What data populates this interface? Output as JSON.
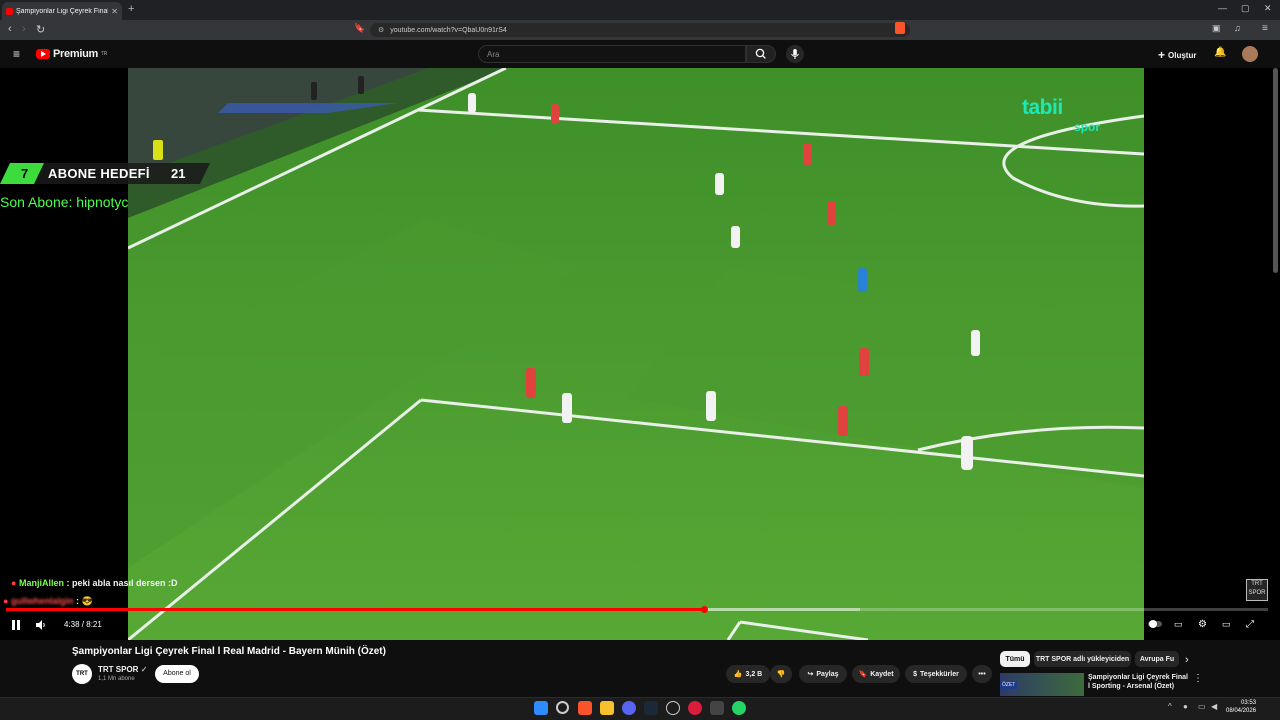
{
  "browser": {
    "tab_title": "Şampiyonlar Ligi Çeyrek Final",
    "url": "youtube.com/watch?v=QbaU0n91rS4",
    "new_tab": "+"
  },
  "header": {
    "logo_text": "Premium",
    "logo_sup": "TR",
    "search_placeholder": "Ara",
    "create_label": "Oluştur"
  },
  "overlay": {
    "abone_current": "7",
    "abone_label": "ABONE HEDEFİ",
    "abone_target": "21",
    "son_abone": "Son Abone: hipnotyc",
    "tabii_big": "tabii",
    "tabii_small": "spor",
    "trt_watermark": "TRT SPOR",
    "chat": [
      {
        "user": "ManjiAllen",
        "message": ": peki abla nasıl dersen :D"
      },
      {
        "user": "gullwhenlalgin",
        "message": ":"
      }
    ]
  },
  "player": {
    "time": "4:38 / 8:21",
    "progress_fraction": 0.553,
    "buffered_fraction": 0.677
  },
  "video": {
    "title": "Şampiyonlar Ligi Çeyrek Final l Real Madrid - Bayern Münih (Özet)",
    "channel": "TRT SPOR",
    "subscribers": "1,1 Mn abone",
    "subscribe_label": "Abone ol",
    "likes": "3,2 B",
    "share_label": "Paylaş",
    "save_label": "Kaydet",
    "thanks_label": "Teşekkürler",
    "more_label": "•••"
  },
  "sidebar": {
    "chips": [
      "Tümü",
      "TRT SPOR adlı yükleyiciden",
      "Avrupa Fu"
    ],
    "recommended": {
      "thumb_badge": "ÖZET",
      "title": "Şampiyonlar Ligi Çeyrek Final l Sporting - Arsenal (Özet)"
    }
  },
  "taskbar": {
    "time": "03:53",
    "date": "08/04/2026"
  },
  "colors": {
    "youtube_red": "#ff0000",
    "pitch_green": "#4f9e2e",
    "abone_green": "#3ddc3d",
    "tabii": "#1de9b6"
  }
}
